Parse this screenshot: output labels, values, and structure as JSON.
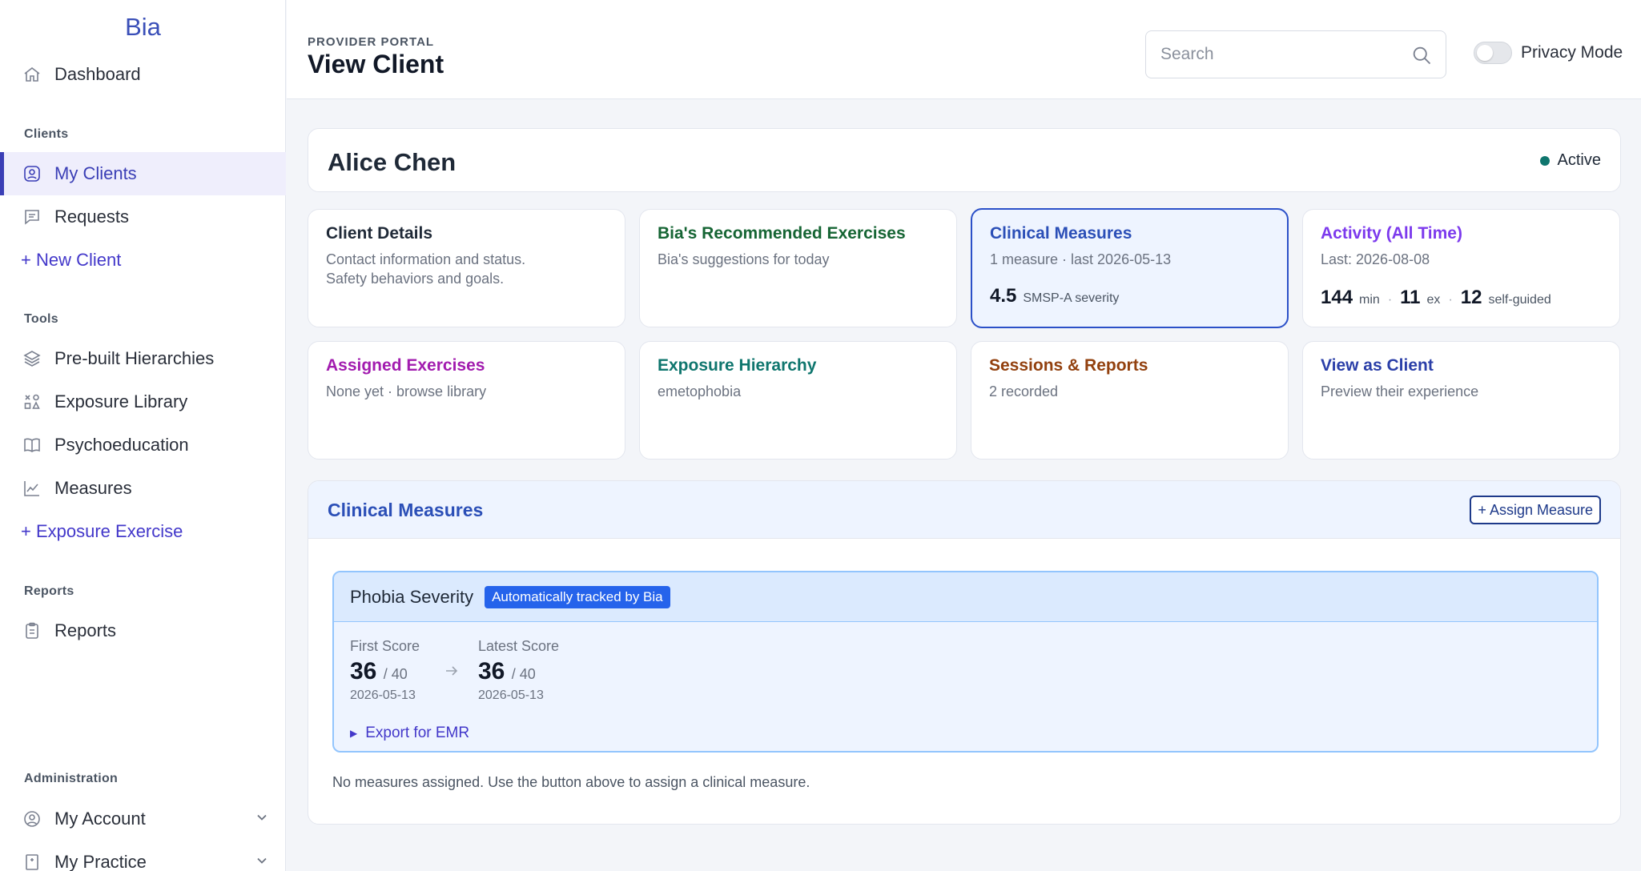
{
  "app": {
    "brand": "Bia"
  },
  "sidebar": {
    "dashboard": "Dashboard",
    "sections": {
      "clients": "Clients",
      "tools": "Tools",
      "reports": "Reports",
      "administration": "Administration"
    },
    "items": {
      "my_clients": "My Clients",
      "requests": "Requests",
      "new_client": "+ New Client",
      "prebuilt": "Pre-built Hierarchies",
      "exposure_library": "Exposure Library",
      "psychoeducation": "Psychoeducation",
      "measures": "Measures",
      "exposure_exercise": "+ Exposure Exercise",
      "reports": "Reports",
      "my_account": "My Account",
      "my_practice": "My Practice"
    }
  },
  "header": {
    "portal": "PROVIDER PORTAL",
    "title": "View Client",
    "search_placeholder": "Search",
    "privacy_label": "Privacy Mode"
  },
  "client": {
    "name": "Alice Chen",
    "status": "Active"
  },
  "tiles": {
    "details": {
      "title": "Client Details",
      "line1": "Contact information and status.",
      "line2": "Safety behaviors and goals."
    },
    "recommended": {
      "title": "Bia's Recommended Exercises",
      "sub": "Bia's suggestions for today"
    },
    "clinical": {
      "title": "Clinical Measures",
      "sub": "1 measure · last 2026-05-13",
      "value": "4.5",
      "unit": "SMSP-A severity"
    },
    "activity": {
      "title": "Activity (All Time)",
      "sub": "Last: 2026-08-08",
      "min_value": "144",
      "min_unit": "min",
      "ex_value": "11",
      "ex_unit": "ex",
      "sg_value": "12",
      "sg_unit": "self-guided"
    },
    "assigned": {
      "title": "Assigned Exercises",
      "sub": "None yet · browse library"
    },
    "hierarchy": {
      "title": "Exposure Hierarchy",
      "sub": "emetophobia"
    },
    "sessions": {
      "title": "Sessions & Reports",
      "sub": "2 recorded"
    },
    "view_as": {
      "title": "View as Client",
      "sub": "Preview their experience"
    }
  },
  "clinical_panel": {
    "title": "Clinical Measures",
    "assign_button": "+ Assign Measure",
    "measure": {
      "name": "Phobia Severity",
      "badge": "Automatically tracked by Bia",
      "first_label": "First Score",
      "first_value": "36",
      "first_max": "/ 40",
      "first_date": "2026-05-13",
      "latest_label": "Latest Score",
      "latest_value": "36",
      "latest_max": "/ 40",
      "latest_date": "2026-05-13",
      "export": "Export for EMR"
    },
    "empty_note": "No measures assigned. Use the button above to assign a clinical measure."
  },
  "colors": {
    "accent": "#3b3fb6",
    "details_title": "#1f2937",
    "recommended_title": "#166534",
    "clinical_title": "#2b4fb7",
    "activity_title": "#7c3aed",
    "assigned_title": "#a21caf",
    "hierarchy_title": "#0f766e",
    "sessions_title": "#92400e",
    "view_as_title": "#2b3fa8"
  }
}
